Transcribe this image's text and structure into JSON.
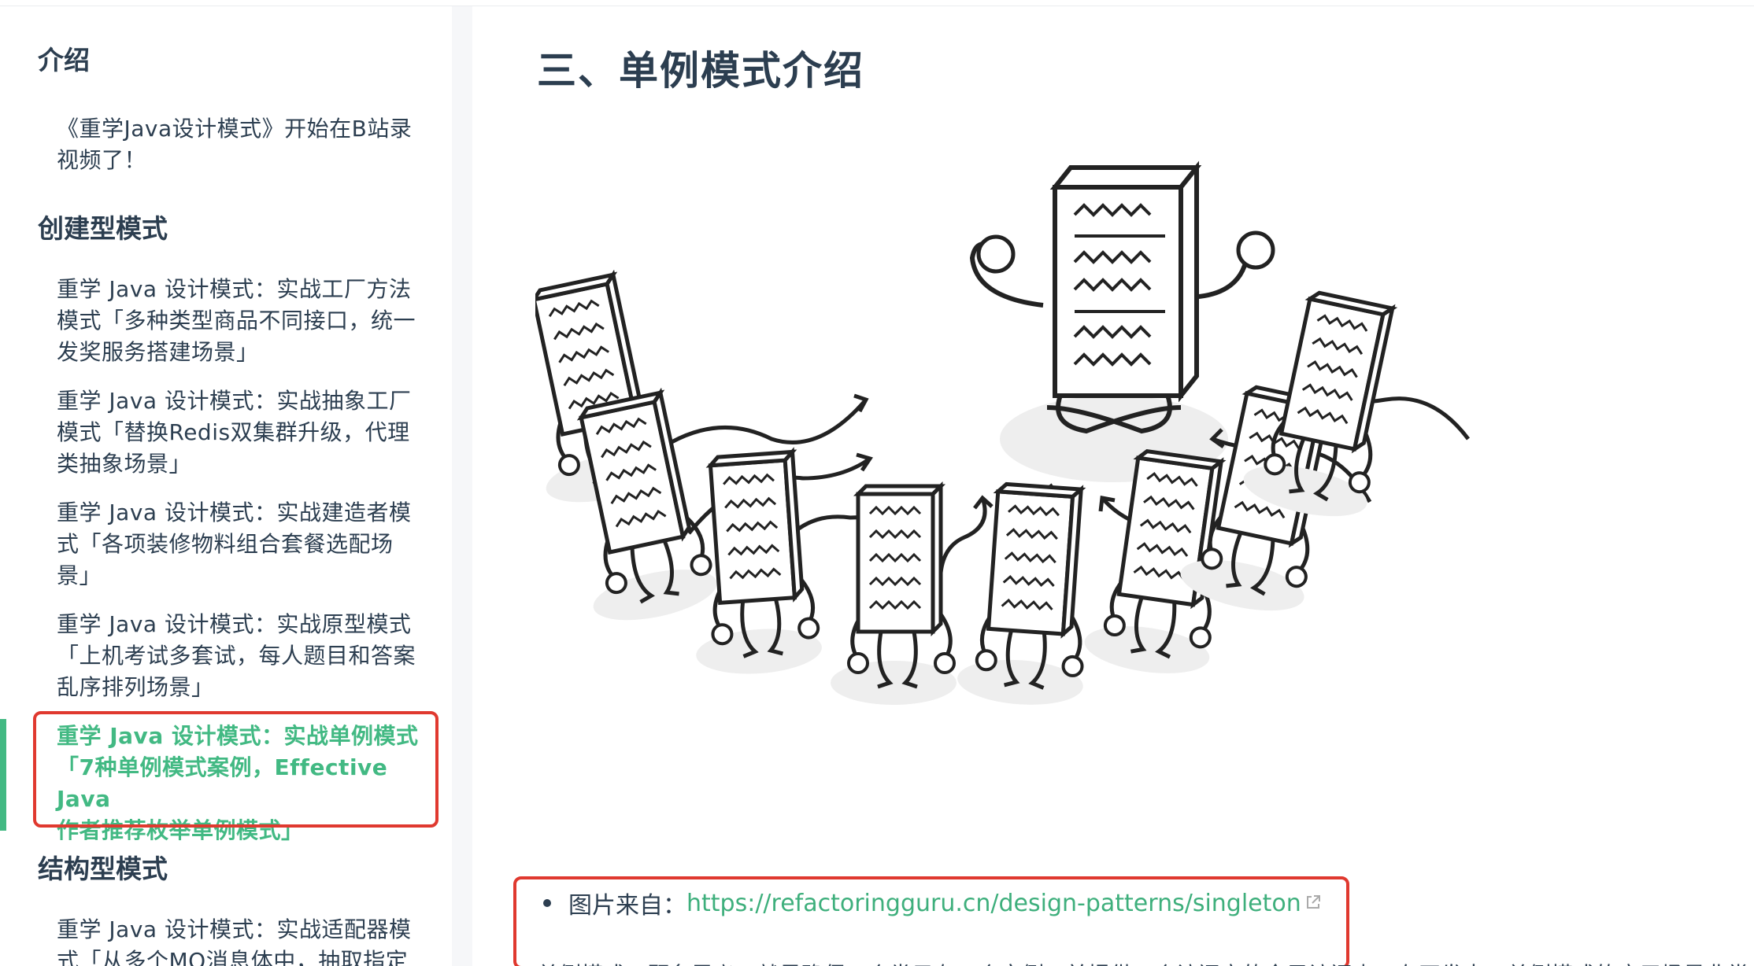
{
  "sidebar": {
    "groups": [
      {
        "title": "介绍",
        "items": [
          {
            "lines": [
              "《重学Java设计模式》开始在B站录",
              "视频了！"
            ]
          }
        ]
      },
      {
        "title": "创建型模式",
        "items": [
          {
            "lines": [
              "重学 Java 设计模式：实战工厂方法",
              "模式「多种类型商品不同接口，统一",
              "发奖服务搭建场景」"
            ]
          },
          {
            "lines": [
              "重学 Java 设计模式：实战抽象工厂",
              "模式「替换Redis双集群升级，代理",
              "类抽象场景」"
            ]
          },
          {
            "lines": [
              "重学 Java 设计模式：实战建造者模",
              "式「各项装修物料组合套餐选配场",
              "景」"
            ]
          },
          {
            "lines": [
              "重学 Java 设计模式：实战原型模式",
              "「上机考试多套试，每人题目和答案",
              "乱序排列场景」"
            ]
          },
          {
            "lines": [
              "重学 Java 设计模式：实战单例模式",
              "「7种单例模式案例，Effective Java",
              "作者推荐枚举单例模式」"
            ],
            "active": true
          }
        ]
      },
      {
        "title": "结构型模式",
        "items": [
          {
            "lines": [
              "重学 Java 设计模式：实战适配器模",
              "式「从多个MQ消息体中，抽取指定"
            ]
          }
        ]
      }
    ]
  },
  "main": {
    "title": "三、单例模式介绍",
    "image_label": "singleton-illustration",
    "source_label": "图片来自：",
    "source_url": "https://refactoringguru.cn/design-patterns/singleton",
    "cut_text": "单例模式，顾名思义，就是确保一个类只有一个实例，并提供一个访问它的全局访问点。在开发中，单例模式的应用场景非常多，比如全局配置"
  },
  "colors": {
    "accent": "#42b983",
    "link": "#3eaf7c",
    "highlight_box": "#e0392f",
    "text": "#2c3e50"
  }
}
